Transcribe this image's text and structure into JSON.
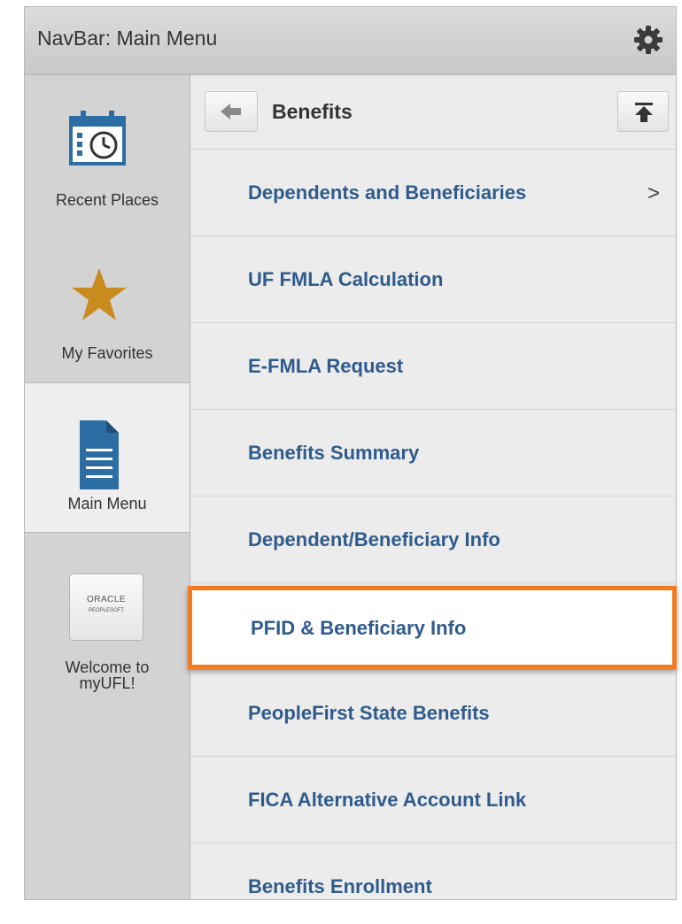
{
  "header": {
    "title": "NavBar: Main Menu",
    "settings_icon": "gear-icon"
  },
  "rail": {
    "items": [
      {
        "label": "Recent Places",
        "icon": "calendar-clock-icon"
      },
      {
        "label": "My Favorites",
        "icon": "star-icon"
      },
      {
        "label": "Main Menu",
        "icon": "document-icon",
        "active": true
      },
      {
        "label": "Welcome to myUFL!",
        "icon": "oracle-peoplesoft-logo",
        "logo_line1": "ORACLE",
        "logo_line2": "PEOPLESOFT"
      }
    ]
  },
  "breadcrumb": {
    "title": "Benefits",
    "back_icon": "back-arrow-icon",
    "top_icon": "scroll-to-top-icon"
  },
  "menu": {
    "items": [
      {
        "label": "Dependents and Beneficiaries",
        "has_children": true,
        "chevron": ">"
      },
      {
        "label": "UF FMLA Calculation"
      },
      {
        "label": "E-FMLA Request"
      },
      {
        "label": "Benefits Summary"
      },
      {
        "label": "Dependent/Beneficiary Info"
      },
      {
        "label": "PFID & Beneficiary Info",
        "highlighted": true
      },
      {
        "label": "PeopleFirst State Benefits"
      },
      {
        "label": "FICA Alternative Account Link"
      },
      {
        "label": "Benefits Enrollment"
      }
    ]
  },
  "colors": {
    "link": "#2f5b8c",
    "highlight_border": "#f07b22",
    "favorites_star": "#c98a1e",
    "icon_blue": "#2c6ea3"
  }
}
